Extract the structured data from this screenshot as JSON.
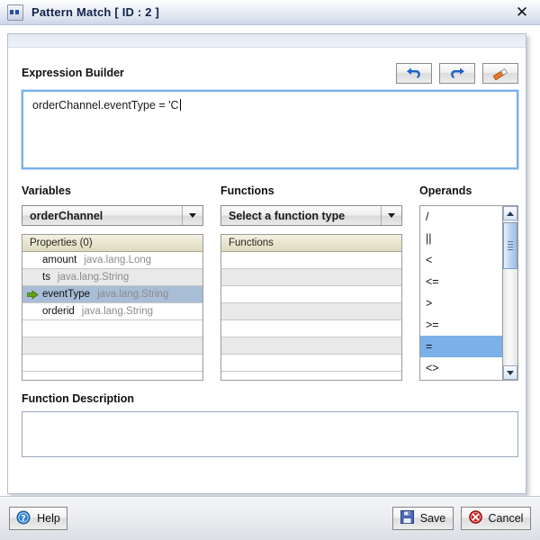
{
  "window": {
    "title": "Pattern Match [ ID : 2 ]",
    "icon": "pattern-match-icon",
    "close_label": "✕"
  },
  "expression_builder": {
    "label": "Expression Builder",
    "value": "orderChannel.eventType = 'C",
    "toolbar": [
      {
        "name": "undo-button",
        "icon": "undo-icon"
      },
      {
        "name": "redo-button",
        "icon": "redo-icon"
      },
      {
        "name": "clear-button",
        "icon": "eraser-icon"
      }
    ]
  },
  "variables": {
    "label": "Variables",
    "selected": "orderChannel",
    "list_header": "Properties (0)",
    "rows": [
      {
        "name": "amount",
        "type": "java.lang.Long",
        "selected": false
      },
      {
        "name": "ts",
        "type": "java.lang.String",
        "selected": false
      },
      {
        "name": "eventType",
        "type": "java.lang.String",
        "selected": true
      },
      {
        "name": "orderid",
        "type": "java.lang.String",
        "selected": false
      },
      {
        "name": "",
        "type": "",
        "selected": false
      },
      {
        "name": "",
        "type": "",
        "selected": false
      },
      {
        "name": "",
        "type": "",
        "selected": false
      }
    ]
  },
  "functions": {
    "label": "Functions",
    "selected": "Select a function type",
    "list_header": "Functions",
    "rows": [
      {
        "name": "",
        "type": ""
      },
      {
        "name": "",
        "type": ""
      },
      {
        "name": "",
        "type": ""
      },
      {
        "name": "",
        "type": ""
      },
      {
        "name": "",
        "type": ""
      },
      {
        "name": "",
        "type": ""
      },
      {
        "name": "",
        "type": ""
      }
    ]
  },
  "operands": {
    "label": "Operands",
    "items": [
      {
        "symbol": "/",
        "selected": false
      },
      {
        "symbol": "||",
        "selected": false
      },
      {
        "symbol": "<",
        "selected": false
      },
      {
        "symbol": "<=",
        "selected": false
      },
      {
        "symbol": ">",
        "selected": false
      },
      {
        "symbol": ">=",
        "selected": false
      },
      {
        "symbol": "=",
        "selected": true
      },
      {
        "symbol": "<>",
        "selected": false
      }
    ]
  },
  "function_description": {
    "label": "Function Description",
    "value": ""
  },
  "footer": {
    "help_label": "Help",
    "save_label": "Save",
    "cancel_label": "Cancel"
  },
  "colors": {
    "selection_blue": "#7bb0e8",
    "row_selected": "#a8bdd6",
    "focus_border": "#7ab0e8",
    "header_beige": "#dedbc0"
  }
}
